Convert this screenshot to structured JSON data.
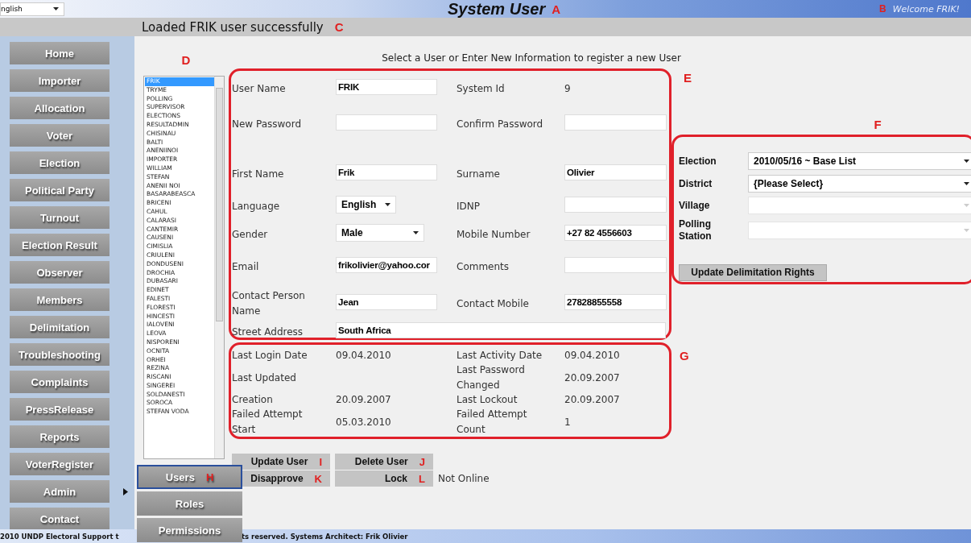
{
  "header": {
    "language": "nglish",
    "title": "System User",
    "title_marker": "A",
    "welcome_marker": "B",
    "welcome": "Welcome FRIK!"
  },
  "status": {
    "message": "Loaded FRIK user successfully",
    "marker": "C"
  },
  "sidebar": {
    "items": [
      {
        "label": "Home",
        "submenu": false
      },
      {
        "label": "Importer",
        "submenu": false
      },
      {
        "label": "Allocation",
        "submenu": false
      },
      {
        "label": "Voter",
        "submenu": false
      },
      {
        "label": "Election",
        "submenu": false
      },
      {
        "label": "Political Party",
        "submenu": false
      },
      {
        "label": "Turnout",
        "submenu": false
      },
      {
        "label": "Election Result",
        "submenu": false
      },
      {
        "label": "Observer",
        "submenu": false
      },
      {
        "label": "Members",
        "submenu": false
      },
      {
        "label": "Delimitation",
        "submenu": false
      },
      {
        "label": "Troubleshooting",
        "submenu": false
      },
      {
        "label": "Complaints",
        "submenu": false
      },
      {
        "label": "PressRelease",
        "submenu": false
      },
      {
        "label": "Reports",
        "submenu": false
      },
      {
        "label": "VoterRegister",
        "submenu": false
      },
      {
        "label": "Admin",
        "submenu": true
      },
      {
        "label": "Contact",
        "submenu": false
      }
    ]
  },
  "submenu": {
    "items": [
      {
        "label": "Users",
        "selected": true,
        "marker": "H"
      },
      {
        "label": "Roles",
        "selected": false
      },
      {
        "label": "Permissions",
        "selected": false
      }
    ]
  },
  "instruction": "Select a User or Enter New Information to register a new User",
  "user_list": {
    "marker": "D",
    "items": [
      {
        "label": "FRIK",
        "selected": true
      },
      {
        "label": "TRYME",
        "selected": false
      },
      {
        "label": "POLLING",
        "selected": false
      },
      {
        "label": "SUPERVISOR",
        "selected": false
      },
      {
        "label": "ELECTIONS",
        "selected": false
      },
      {
        "label": "RESULTADMIN",
        "selected": false
      },
      {
        "label": "CHISINAU",
        "selected": false
      },
      {
        "label": "BALTI",
        "selected": false
      },
      {
        "label": "ANENIINOI",
        "selected": false
      },
      {
        "label": "IMPORTER",
        "selected": false
      },
      {
        "label": "WILLIAM",
        "selected": false
      },
      {
        "label": "STEFAN",
        "selected": false
      },
      {
        "label": "ANENII NOI",
        "selected": false
      },
      {
        "label": "BASARABEASCA",
        "selected": false
      },
      {
        "label": "BRICENI",
        "selected": false
      },
      {
        "label": "CAHUL",
        "selected": false
      },
      {
        "label": "CALARASI",
        "selected": false
      },
      {
        "label": "CANTEMIR",
        "selected": false
      },
      {
        "label": "CAUSENI",
        "selected": false
      },
      {
        "label": "CIMISLIA",
        "selected": false
      },
      {
        "label": "CRIULENI",
        "selected": false
      },
      {
        "label": "DONDUSENI",
        "selected": false
      },
      {
        "label": "DROCHIA",
        "selected": false
      },
      {
        "label": "DUBASARI",
        "selected": false
      },
      {
        "label": "EDINET",
        "selected": false
      },
      {
        "label": "FALESTI",
        "selected": false
      },
      {
        "label": "FLORESTI",
        "selected": false
      },
      {
        "label": "HINCESTI",
        "selected": false
      },
      {
        "label": "IALOVENI",
        "selected": false
      },
      {
        "label": "LEOVA",
        "selected": false
      },
      {
        "label": "NISPORENI",
        "selected": false
      },
      {
        "label": "OCNITA",
        "selected": false
      },
      {
        "label": "ORHEI",
        "selected": false
      },
      {
        "label": "REZINA",
        "selected": false
      },
      {
        "label": "RISCANI",
        "selected": false
      },
      {
        "label": "SINGEREI",
        "selected": false
      },
      {
        "label": "SOLDANESTI",
        "selected": false
      },
      {
        "label": "SOROCA",
        "selected": false
      },
      {
        "label": "STEFAN VODA",
        "selected": false
      }
    ]
  },
  "user_form": {
    "marker": "E",
    "rows": [
      {
        "left": {
          "label": "User Name",
          "kind": "input",
          "value": "FRIK"
        },
        "right": {
          "label": "System Id",
          "kind": "text",
          "value": "9"
        }
      },
      {
        "left": {
          "label": "New Password",
          "kind": "input"
        },
        "right": {
          "label": "Confirm Password",
          "kind": "input"
        }
      },
      {
        "left": {
          "label": "First Name",
          "kind": "input",
          "value": "Frik"
        },
        "right": {
          "label": "Surname",
          "kind": "input",
          "value": "Olivier"
        }
      },
      {
        "left": {
          "label": "Language",
          "kind": "select",
          "value": "English"
        },
        "right": {
          "label": "IDNP",
          "kind": "input"
        }
      },
      {
        "left": {
          "label": "Gender",
          "kind": "select",
          "value": "Male"
        },
        "right": {
          "label": "Mobile Number",
          "kind": "input",
          "value": "+27 82 4556603"
        }
      },
      {
        "left": {
          "label": "Email",
          "kind": "input",
          "value": "frikolivier@yahoo.cor"
        },
        "right": {
          "label": "Comments",
          "kind": "input"
        }
      },
      {
        "left": {
          "label": "Contact Person Name",
          "kind": "input",
          "value": "Jean"
        },
        "right": {
          "label": "Contact Mobile",
          "kind": "input",
          "value": "27828855558"
        }
      }
    ],
    "street_address": {
      "label": "Street Address",
      "value": "South Africa"
    }
  },
  "user_info": {
    "marker": "G",
    "rows": [
      {
        "left": {
          "label": "Last Login Date",
          "value": "09.04.2010"
        },
        "right": {
          "label": "Last Activity Date",
          "value": "09.04.2010"
        }
      },
      {
        "left": {
          "label": "Last Updated"
        },
        "right": {
          "label": "Last Password Changed",
          "value": "20.09.2007"
        }
      },
      {
        "left": {
          "label": "Creation",
          "value": "20.09.2007"
        },
        "right": {
          "label": "Last Lockout",
          "value": "20.09.2007"
        }
      },
      {
        "left": {
          "label": "Failed Attempt Start",
          "value": "05.03.2010"
        },
        "right": {
          "label": "Failed Attempt Count",
          "value": "1"
        }
      }
    ]
  },
  "actions": {
    "buttons": [
      {
        "label": "Update User",
        "marker": "I"
      },
      {
        "label": "Delete User",
        "marker": "J"
      },
      {
        "label": "Disapprove",
        "marker": "K"
      },
      {
        "label": "Lock",
        "marker": "L"
      }
    ],
    "online_status": "Not Online"
  },
  "delimitation": {
    "marker": "F",
    "fields": [
      {
        "label": "Election",
        "value": "2010/05/16 ~ Base List",
        "disabled": false
      },
      {
        "label": "District",
        "value": "{Please Select}",
        "disabled": false
      },
      {
        "label": "Village",
        "disabled": true
      },
      {
        "label": "Polling Station",
        "disabled": true
      }
    ],
    "button": "Update Delimitation Rights"
  },
  "footer": {
    "left": "2010 UNDP Electoral Support t",
    "right": "ts reserved. Systems Architect: Frik Olivier"
  }
}
